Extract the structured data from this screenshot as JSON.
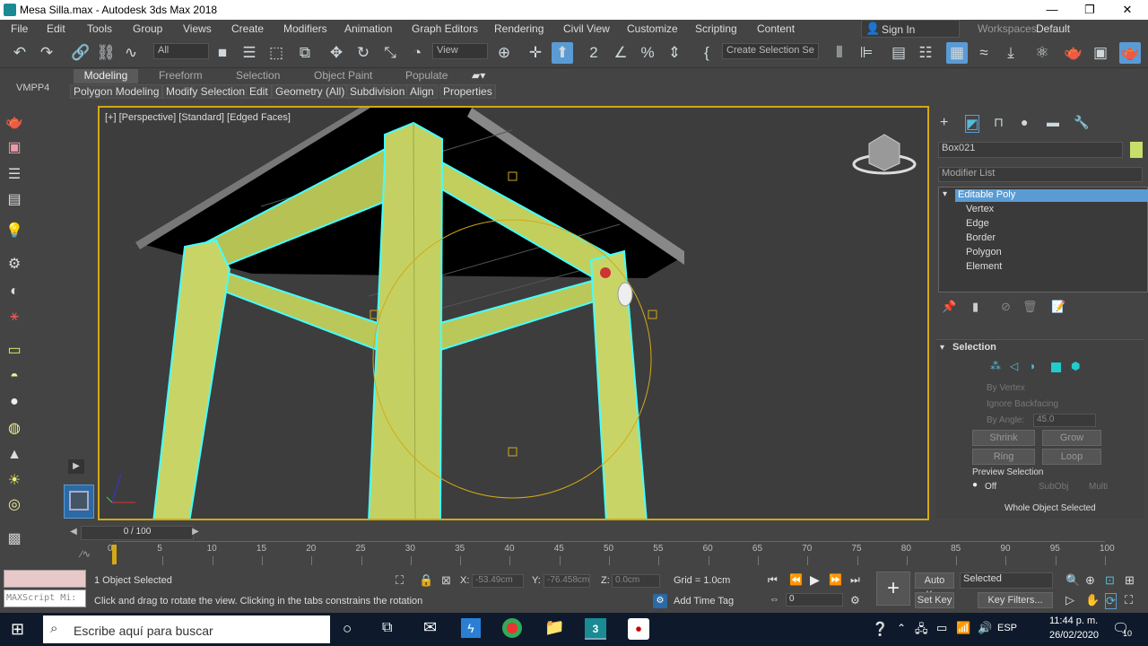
{
  "window": {
    "title": "Mesa Silla.max - Autodesk 3ds Max 2018",
    "minimize": "—",
    "maximize": "❐",
    "close": "✕"
  },
  "menu": {
    "items": [
      "File",
      "Edit",
      "Tools",
      "Group",
      "Views",
      "Create",
      "Modifiers",
      "Animation",
      "Graph Editors",
      "Rendering",
      "Civil View",
      "Customize",
      "Scripting",
      "Content"
    ],
    "sign_in": "Sign In",
    "workspaces_label": "Workspaces:",
    "workspaces_value": "Default"
  },
  "toolbar": {
    "filter_dropdown": "All",
    "reference_dropdown": "View",
    "selection_set": "Create Selection Se"
  },
  "ribbon": {
    "tabs": [
      "Modeling",
      "Freeform",
      "Selection",
      "Object Paint",
      "Populate"
    ],
    "sub_tabs": [
      "Polygon Modeling",
      "Modify Selection",
      "Edit",
      "Geometry (All)",
      "Subdivision",
      "Align",
      "Properties"
    ],
    "left_label": "VMPP4"
  },
  "viewport": {
    "label": "[+] [Perspective] [Standard] [Edged Faces]"
  },
  "command_panel": {
    "object_name": "Box021",
    "object_color": "#c8de6a",
    "modifier_list": "Modifier List",
    "stack": [
      "Editable Poly",
      "Vertex",
      "Edge",
      "Border",
      "Polygon",
      "Element"
    ],
    "selection_rollout": {
      "title": "Selection",
      "by_vertex": "By Vertex",
      "ignore_backfacing": "Ignore Backfacing",
      "by_angle": "By Angle:",
      "angle_value": "45.0",
      "shrink": "Shrink",
      "grow": "Grow",
      "ring": "Ring",
      "loop": "Loop",
      "preview_selection": "Preview Selection",
      "off": "Off",
      "subobj": "SubObj",
      "multi": "Multi",
      "status": "Whole Object Selected"
    }
  },
  "timeline": {
    "frame_display": "0 / 100",
    "ticks": [
      "0",
      "5",
      "10",
      "15",
      "20",
      "25",
      "30",
      "35",
      "40",
      "45",
      "50",
      "55",
      "60",
      "65",
      "70",
      "75",
      "80",
      "85",
      "90",
      "95",
      "100"
    ]
  },
  "status": {
    "maxscript": "MAXScript Mi:",
    "selected": "1 Object Selected",
    "prompt": "Click and drag to rotate the view.  Clicking in the tabs constrains the rotation",
    "x_label": "X:",
    "x_value": "-53.49cm",
    "y_label": "Y:",
    "y_value": "-76.458cm",
    "z_label": "Z:",
    "z_value": "0.0cm",
    "grid": "Grid = 1.0cm",
    "add_time_tag": "Add Time Tag",
    "auto_key": "Auto Key",
    "set_key": "Set Key",
    "key_mode": "Selected",
    "key_filters": "Key Filters...",
    "frame_value": "0"
  },
  "taskbar": {
    "search_placeholder": "Escribe aquí para buscar",
    "lang": "ESP",
    "time": "11:44 p. m.",
    "date": "26/02/2020",
    "notif_count": "10"
  }
}
